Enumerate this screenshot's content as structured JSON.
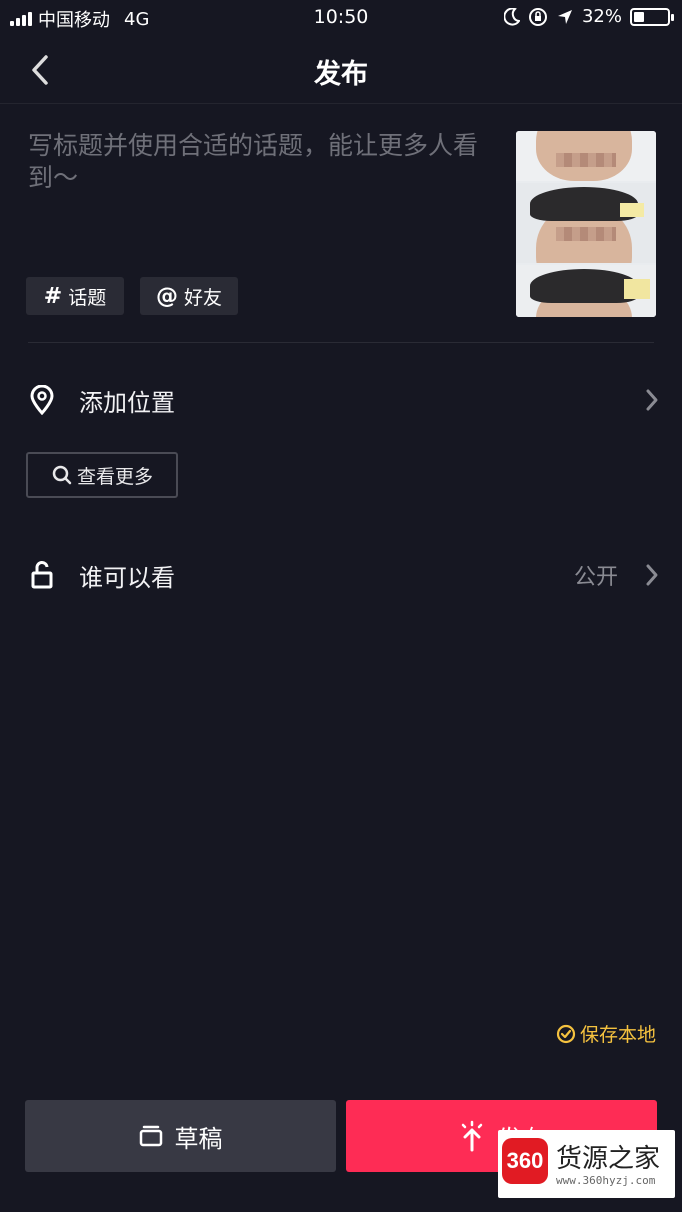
{
  "status_bar": {
    "carrier": "中国移动",
    "network": "4G",
    "time": "10:50",
    "battery_percent": "32%",
    "battery_level": 0.32
  },
  "nav": {
    "title": "发布"
  },
  "caption": {
    "placeholder": "写标题并使用合适的话题，能让更多人看到～",
    "value": ""
  },
  "tags": [
    {
      "symbol": "#",
      "label": "话题"
    },
    {
      "symbol": "@",
      "label": "好友"
    }
  ],
  "location": {
    "label": "添加位置"
  },
  "more": {
    "label": "查看更多"
  },
  "visibility": {
    "label": "谁可以看",
    "value": "公开"
  },
  "save_local": {
    "label": "保存本地",
    "checked": true
  },
  "bottom": {
    "draft_label": "草稿",
    "publish_label": "发布"
  },
  "watermark": {
    "logo_text": "360",
    "name": "货源之家",
    "url": "www.360hyzj.com"
  },
  "colors": {
    "background": "#161722",
    "accent": "#fe2c55",
    "save_local": "#f5c23f"
  }
}
